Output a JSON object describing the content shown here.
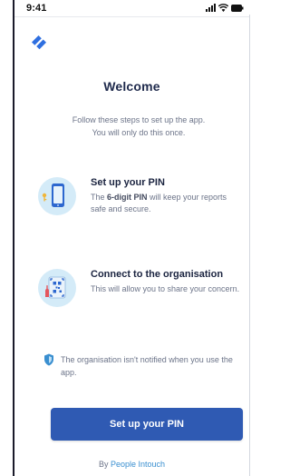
{
  "status_bar": {
    "time": "9:41"
  },
  "app": {
    "logo_icon": "brand-swoosh-icon",
    "accent_color": "#2f5ab3",
    "logo_color": "#2f6fe0"
  },
  "welcome": {
    "title": "Welcome",
    "intro_line1": "Follow these steps to set up the app.",
    "intro_line2": "You will only do this once."
  },
  "steps": [
    {
      "icon": "phone-pin-icon",
      "title": "Set up your PIN",
      "desc_pre": "The ",
      "desc_bold": "6-digit PIN",
      "desc_post": " will keep your reports safe and secure."
    },
    {
      "icon": "qr-scan-icon",
      "title": "Connect to the organisation",
      "desc": "This will allow you to share your concern."
    }
  ],
  "notice": {
    "icon": "shield-icon",
    "text": "The organisation isn't notified when you use the app."
  },
  "cta": {
    "label": "Set up your PIN"
  },
  "footer": {
    "prefix": "By",
    "brand": "People Intouch"
  }
}
